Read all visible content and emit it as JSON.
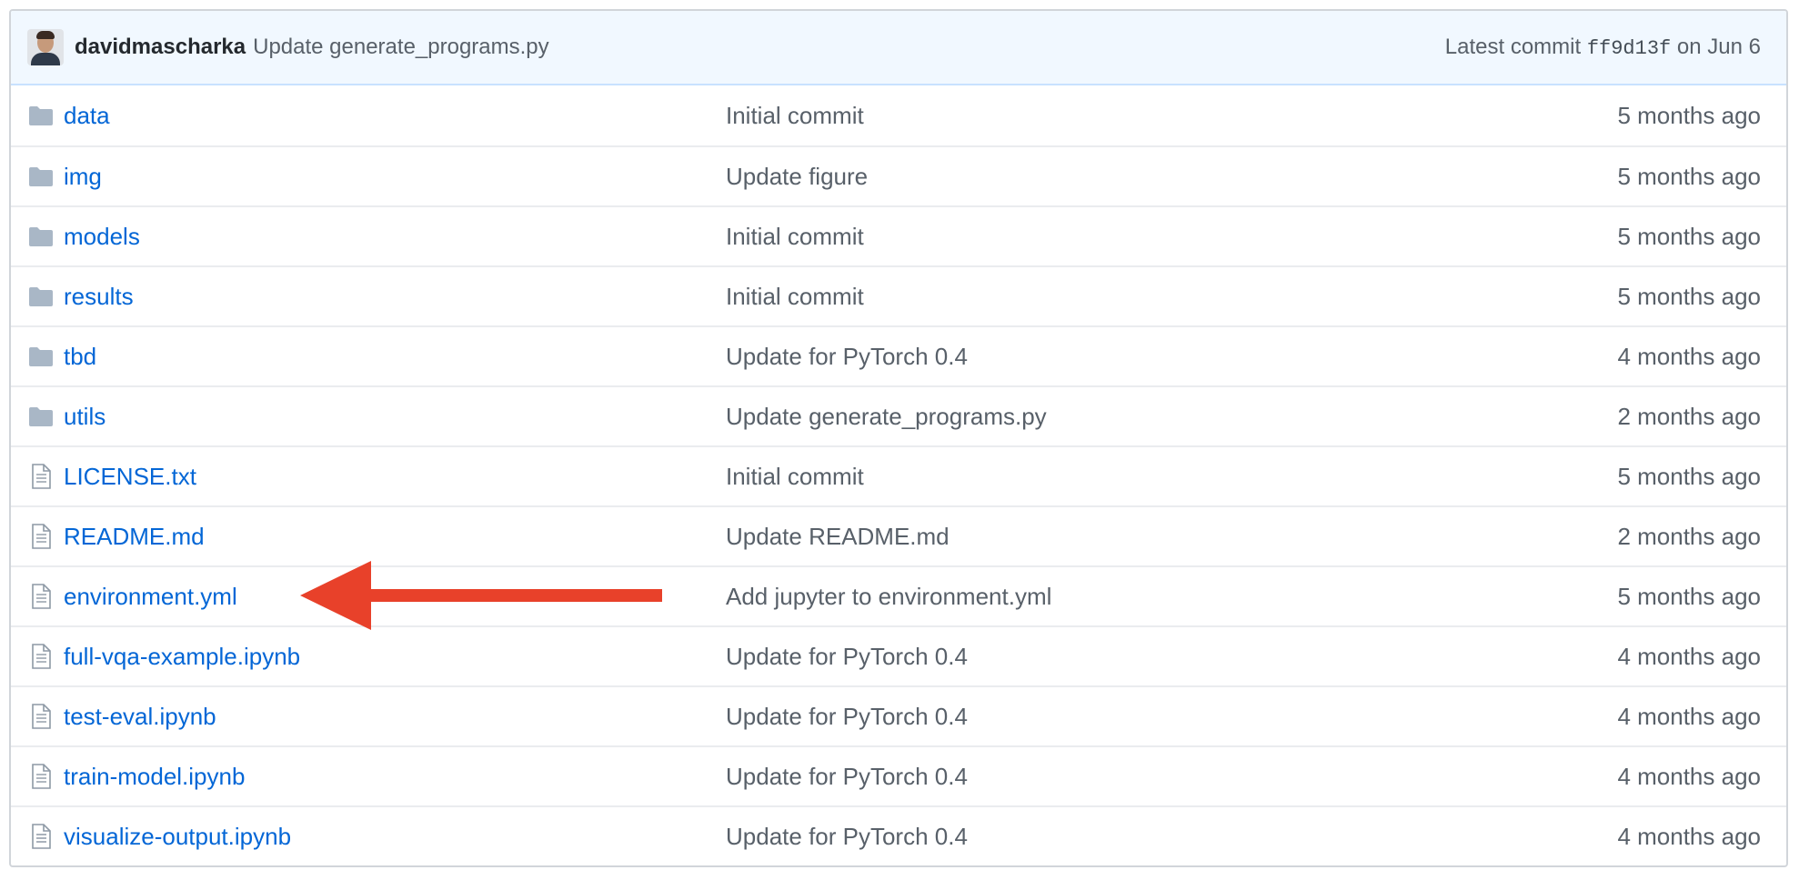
{
  "commit_bar": {
    "author": "davidmascharka",
    "message": "Update generate_programs.py",
    "latest_label": "Latest commit",
    "sha": "ff9d13f",
    "date": "on Jun 6"
  },
  "files": [
    {
      "name": "data",
      "type": "folder",
      "message": "Initial commit",
      "age": "5 months ago"
    },
    {
      "name": "img",
      "type": "folder",
      "message": "Update figure",
      "age": "5 months ago"
    },
    {
      "name": "models",
      "type": "folder",
      "message": "Initial commit",
      "age": "5 months ago"
    },
    {
      "name": "results",
      "type": "folder",
      "message": "Initial commit",
      "age": "5 months ago"
    },
    {
      "name": "tbd",
      "type": "folder",
      "message": "Update for PyTorch 0.4",
      "age": "4 months ago"
    },
    {
      "name": "utils",
      "type": "folder",
      "message": "Update generate_programs.py",
      "age": "2 months ago"
    },
    {
      "name": "LICENSE.txt",
      "type": "file",
      "message": "Initial commit",
      "age": "5 months ago"
    },
    {
      "name": "README.md",
      "type": "file",
      "message": "Update README.md",
      "age": "2 months ago"
    },
    {
      "name": "environment.yml",
      "type": "file",
      "message": "Add jupyter to environment.yml",
      "age": "5 months ago"
    },
    {
      "name": "full-vqa-example.ipynb",
      "type": "file",
      "message": "Update for PyTorch 0.4",
      "age": "4 months ago"
    },
    {
      "name": "test-eval.ipynb",
      "type": "file",
      "message": "Update for PyTorch 0.4",
      "age": "4 months ago"
    },
    {
      "name": "train-model.ipynb",
      "type": "file",
      "message": "Update for PyTorch 0.4",
      "age": "4 months ago"
    },
    {
      "name": "visualize-output.ipynb",
      "type": "file",
      "message": "Update for PyTorch 0.4",
      "age": "4 months ago"
    }
  ],
  "icons": {
    "folder": "folder-icon",
    "file": "file-icon",
    "annotation": "arrow-icon"
  },
  "colors": {
    "link": "#0366d6",
    "muted": "#586069",
    "folder_icon": "#a9b7c6",
    "commit_bar_bg": "#f1f8ff",
    "annotation_arrow": "#e8412a"
  }
}
